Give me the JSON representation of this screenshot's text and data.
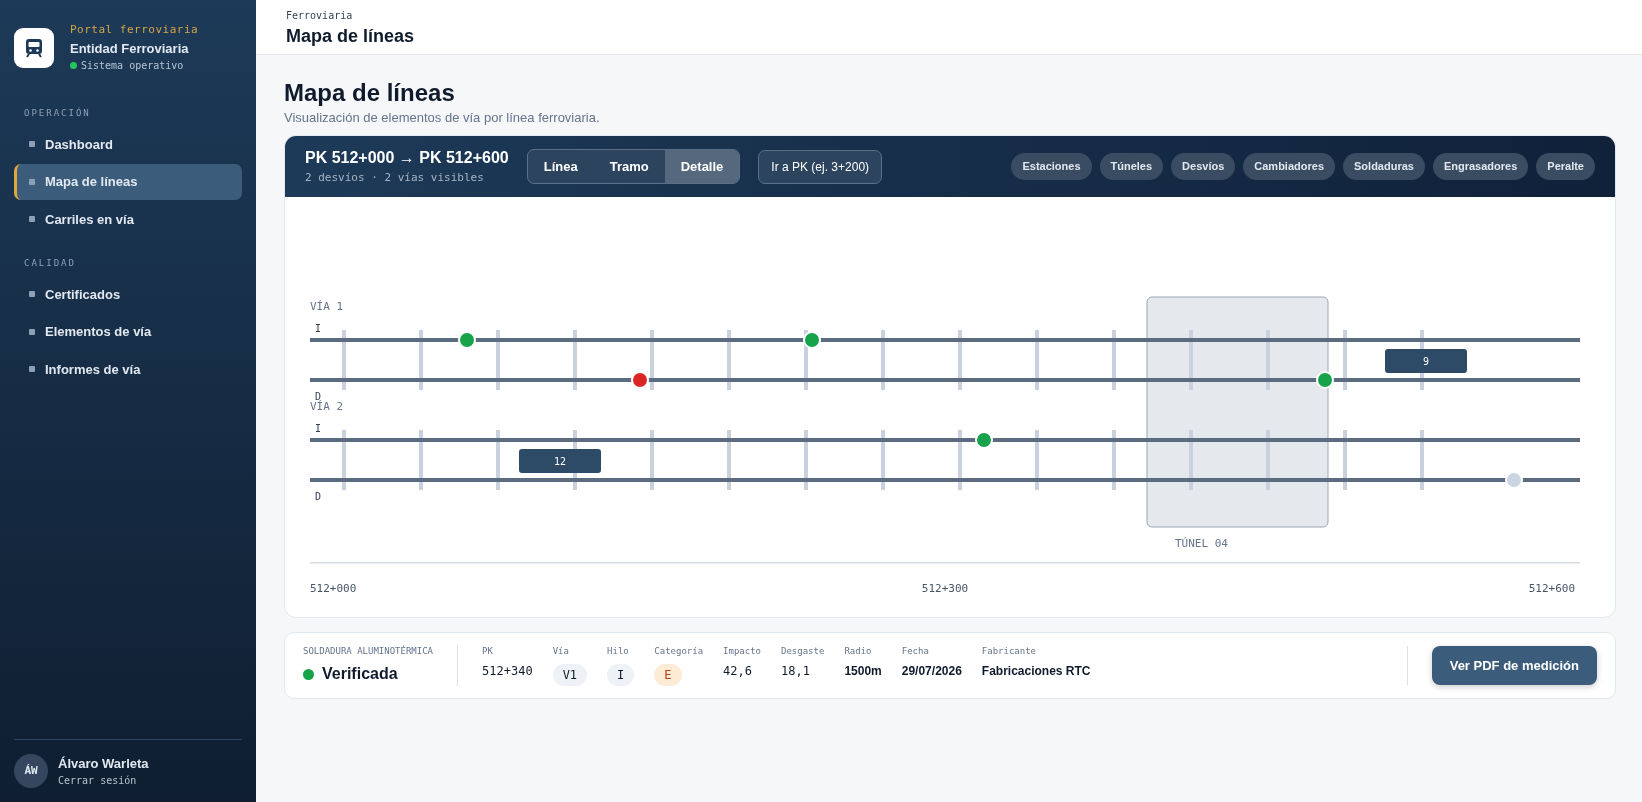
{
  "sidebar": {
    "brand_kicker": "Portal ferroviaria",
    "brand_name": "Entidad Ferroviaria",
    "status": "Sistema operativo",
    "sections": [
      {
        "title": "OPERACIÓN",
        "items": [
          {
            "label": "Dashboard",
            "selected": false
          },
          {
            "label": "Mapa de líneas",
            "selected": true
          },
          {
            "label": "Carriles en vía",
            "selected": false
          }
        ]
      },
      {
        "title": "CALIDAD",
        "items": [
          {
            "label": "Certificados",
            "selected": false
          },
          {
            "label": "Elementos de vía",
            "selected": false
          },
          {
            "label": "Informes de vía",
            "selected": false
          }
        ]
      }
    ],
    "user": {
      "initials": "ÁW",
      "name": "Álvaro Warleta",
      "logout": "Cerrar sesión"
    }
  },
  "topbar": {
    "breadcrumb": "Ferroviaria",
    "title": "Mapa de líneas"
  },
  "page": {
    "title": "Mapa de líneas",
    "subtitle": "Visualización de elementos de vía por línea ferroviaria."
  },
  "map": {
    "range": "PK 512+000 → PK 512+600",
    "summary": "2 desvíos · 2 vías visibles",
    "views": [
      {
        "label": "Línea",
        "selected": false
      },
      {
        "label": "Tramo",
        "selected": false
      },
      {
        "label": "Detalle",
        "selected": true
      }
    ],
    "goto": "Ir a PK (ej. 3+200)",
    "filters": [
      "Estaciones",
      "Túneles",
      "Desvíos",
      "Cambiadores",
      "Soldaduras",
      "Engrasadores",
      "Peralte"
    ],
    "tracks": [
      {
        "name": "VÍA 1",
        "rails": [
          {
            "label": "I",
            "markers": [
              {
                "color": "#16a34a"
              },
              {
                "color": "#16a34a"
              }
            ]
          },
          {
            "label": "D",
            "markers": [
              {
                "color": "#dc2626"
              },
              {
                "color": "#16a34a"
              }
            ]
          }
        ],
        "tag": "9"
      },
      {
        "name": "VÍA 2",
        "rails": [
          {
            "label": "I",
            "markers": [
              {
                "color": "#16a34a"
              }
            ]
          },
          {
            "label": "D",
            "markers": [
              {
                "color": "#cbd5e1"
              }
            ]
          }
        ],
        "tag": "12"
      }
    ],
    "tunnel": "TÚNEL 04",
    "axis": [
      "512+000",
      "512+300",
      "512+600"
    ]
  },
  "detail": {
    "type": "SOLDADURA ALUMINOTÉRMICA",
    "status": "Verificada",
    "fields": [
      {
        "label": "PK",
        "value": "512+340",
        "kind": "text"
      },
      {
        "label": "Vía",
        "value": "V1",
        "kind": "chip"
      },
      {
        "label": "Hilo",
        "value": "I",
        "kind": "chip"
      },
      {
        "label": "Categoría",
        "value": "E",
        "kind": "warn"
      },
      {
        "label": "Impacto",
        "value": "42,6",
        "kind": "text"
      },
      {
        "label": "Desgaste",
        "value": "18,1",
        "kind": "text"
      },
      {
        "label": "Radio",
        "value": "1500m",
        "kind": "bold"
      },
      {
        "label": "Fecha",
        "value": "29/07/2026",
        "kind": "bold"
      },
      {
        "label": "Fabricante",
        "value": "Fabricaciones RTC",
        "kind": "bold"
      }
    ],
    "action": "Ver PDF de medición"
  }
}
